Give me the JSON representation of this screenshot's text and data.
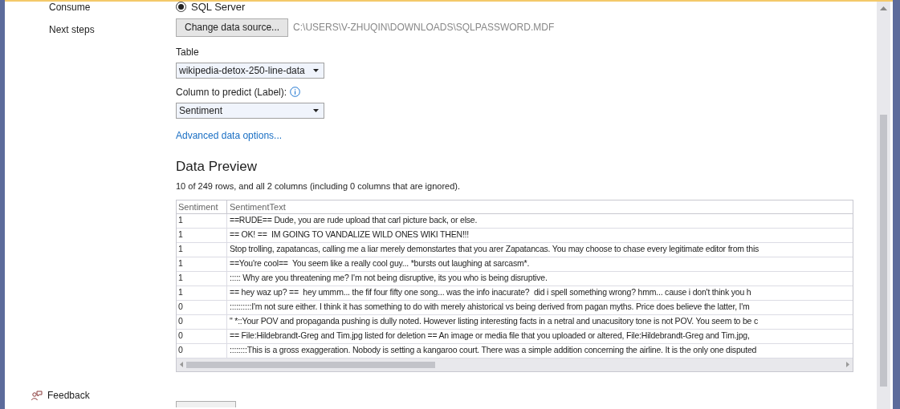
{
  "nav": {
    "items": [
      {
        "label": "Consume"
      },
      {
        "label": "Next steps"
      }
    ],
    "feedback": "Feedback"
  },
  "source": {
    "radio": {
      "label": "SQL Server",
      "selected": true
    },
    "change_button": "Change data source...",
    "path": "C:\\USERS\\V-ZHUQIN\\DOWNLOADS\\SQLPASSWORD.MDF"
  },
  "table_field": {
    "label": "Table",
    "value": "wikipedia-detox-250-line-data"
  },
  "label_field": {
    "label": "Column to predict (Label):",
    "value": "Sentiment"
  },
  "advanced_link": "Advanced data options...",
  "preview": {
    "title": "Data Preview",
    "summary": "10 of 249 rows, and all 2 columns (including 0 columns that are ignored).",
    "columns": [
      "Sentiment",
      "SentimentText"
    ],
    "rows": [
      [
        "1",
        "==RUDE== Dude, you are rude upload that carl picture back, or else."
      ],
      [
        "1",
        "== OK! ==  IM GOING TO VANDALIZE WILD ONES WIKI THEN!!!"
      ],
      [
        "1",
        "Stop trolling, zapatancas, calling me a liar merely demonstartes that you arer Zapatancas. You may choose to chase every legitimate editor from this"
      ],
      [
        "1",
        "==You're cool==  You seem like a really cool guy... *bursts out laughing at sarcasm*."
      ],
      [
        "1",
        "::::: Why are you threatening me? I'm not being disruptive, its you who is being disruptive."
      ],
      [
        "1",
        "== hey waz up? ==  hey ummm... the fif four fifty one song... was the info inacurate?  did i spell something wrong? hmm... cause i don't think you h"
      ],
      [
        "0",
        "::::::::::I'm not sure either. I think it has something to do with merely ahistorical vs being derived from pagan myths. Price does believe the latter, I'm"
      ],
      [
        "0",
        "\" *::Your POV and propaganda pushing is dully noted. However listing interesting facts in a netral and unacusitory tone is not POV. You seem to be c"
      ],
      [
        "0",
        "== File:Hildebrandt-Greg and Tim.jpg listed for deletion == An image or media file that you uploaded or altered, File:Hildebrandt-Greg and Tim.jpg,"
      ],
      [
        "0",
        "::::::::This is a gross exaggeration. Nobody is setting a kangaroo court. There was a simple addition concerning the airline. It is the only one disputed"
      ]
    ]
  }
}
